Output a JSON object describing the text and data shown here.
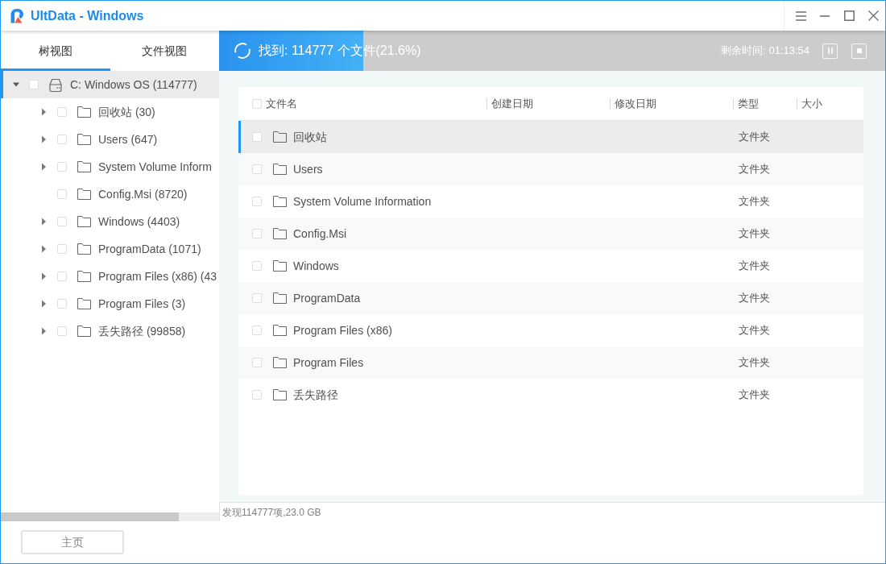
{
  "window": {
    "title": "UltData - Windows"
  },
  "sidebar": {
    "tabs": [
      {
        "label": "树视图",
        "selected": true
      },
      {
        "label": "文件视图",
        "selected": false
      }
    ],
    "tree": [
      {
        "label": "C: Windows OS (114777)",
        "kind": "drive",
        "has_children": true,
        "expanded": true,
        "checked": false,
        "selected": true,
        "children": [
          {
            "label": "回收站 (30)",
            "kind": "folder",
            "has_children": true,
            "expanded": false,
            "checked": false,
            "selected": false
          },
          {
            "label": "Users (647)",
            "kind": "folder",
            "has_children": true,
            "expanded": false,
            "checked": false,
            "selected": false
          },
          {
            "label": "System Volume Inform",
            "kind": "folder",
            "has_children": true,
            "expanded": false,
            "checked": false,
            "selected": false
          },
          {
            "label": "Config.Msi (8720)",
            "kind": "folder",
            "has_children": false,
            "checked": false,
            "selected": false
          },
          {
            "label": "Windows (4403)",
            "kind": "folder",
            "has_children": true,
            "expanded": false,
            "checked": false,
            "selected": false
          },
          {
            "label": "ProgramData (1071)",
            "kind": "folder",
            "has_children": true,
            "expanded": false,
            "checked": false,
            "selected": false
          },
          {
            "label": "Program Files (x86) (43",
            "kind": "folder",
            "has_children": true,
            "expanded": false,
            "checked": false,
            "selected": false
          },
          {
            "label": "Program Files (3)",
            "kind": "folder",
            "has_children": true,
            "expanded": false,
            "checked": false,
            "selected": false
          },
          {
            "label": "丢失路径 (99858)",
            "kind": "folder",
            "has_children": true,
            "expanded": false,
            "checked": false,
            "selected": false
          }
        ]
      }
    ]
  },
  "scan": {
    "status": "找到: 114777 个文件(21.6%)",
    "level": 0.216,
    "remaining": "剩余时间: 01:13:54"
  },
  "table": {
    "select_all": {
      "checked": false
    },
    "columns": [
      "文件名",
      "创建日期",
      "修改日期",
      "类型",
      "大小"
    ],
    "rows": [
      {
        "name": "回收站",
        "type": "文件夹",
        "checked": false,
        "selected": true
      },
      {
        "name": "Users",
        "type": "文件夹",
        "checked": false,
        "selected": false
      },
      {
        "name": "System Volume Information",
        "type": "文件夹",
        "checked": false,
        "selected": false
      },
      {
        "name": "Config.Msi",
        "type": "文件夹",
        "checked": false,
        "selected": false
      },
      {
        "name": "Windows",
        "type": "文件夹",
        "checked": false,
        "selected": false
      },
      {
        "name": "ProgramData",
        "type": "文件夹",
        "checked": false,
        "selected": false
      },
      {
        "name": "Program Files (x86)",
        "type": "文件夹",
        "checked": false,
        "selected": false
      },
      {
        "name": "Program Files",
        "type": "文件夹",
        "checked": false,
        "selected": false
      },
      {
        "name": "丢失路径",
        "type": "文件夹",
        "checked": false,
        "selected": false
      }
    ]
  },
  "status_bar": "发现114777项,23.0 GB",
  "buttons": [
    {
      "label": "主页"
    }
  ]
}
